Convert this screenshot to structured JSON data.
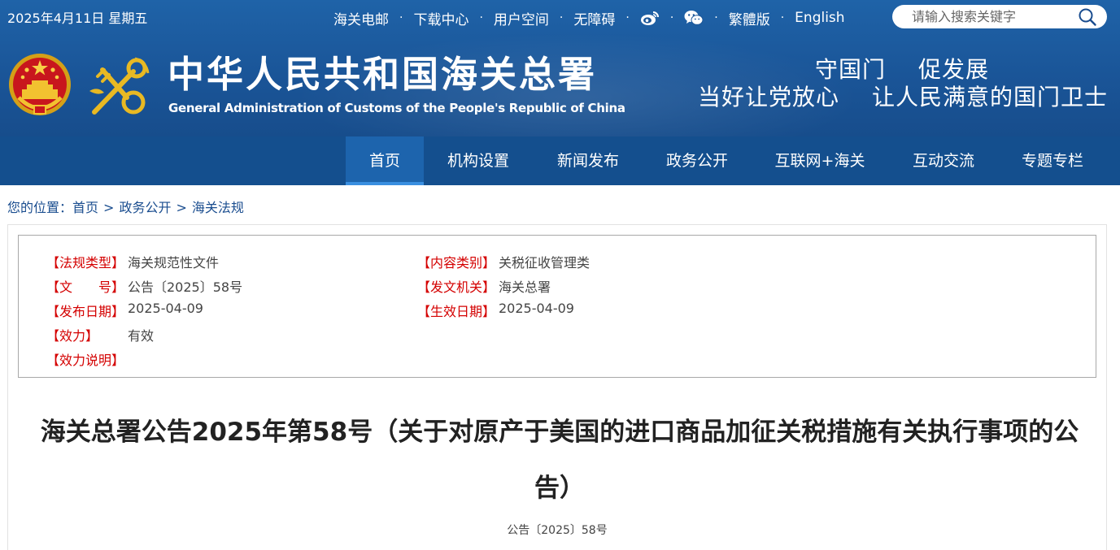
{
  "topbar": {
    "date": "2025年4月11日 星期五",
    "links": [
      "海关电邮",
      "下载中心",
      "用户空间",
      "无障碍",
      "繁體版",
      "English"
    ],
    "weibo_icon": "weibo-icon",
    "wechat_icon": "wechat-icon",
    "search_placeholder": "请输入搜索关键字"
  },
  "header": {
    "title": "中华人民共和国海关总署",
    "subtitle": "General Administration of Customs of the People's Republic of China",
    "slogan_line1": [
      "守国门",
      "促发展"
    ],
    "slogan_line2": [
      "当好让党放心",
      "让人民满意的国门卫士"
    ]
  },
  "nav": {
    "items": [
      "首页",
      "机构设置",
      "新闻发布",
      "政务公开",
      "互联网+海关",
      "互动交流",
      "专题专栏"
    ],
    "active_index": 0
  },
  "breadcrumb": {
    "prefix": "您的位置：",
    "items": [
      "首页",
      "政务公开",
      "海关法规"
    ],
    "separator": ">"
  },
  "meta": {
    "left": [
      {
        "key": "【法规类型】",
        "value": "海关规范性文件"
      },
      {
        "key": "【文　　号】",
        "value": "公告〔2025〕58号"
      },
      {
        "key": "【发布日期】",
        "value": "2025-04-09"
      },
      {
        "key": "【效力】",
        "value": "有效"
      },
      {
        "key": "【效力说明】",
        "value": ""
      }
    ],
    "right": [
      {
        "key": "【内容类别】",
        "value": "关税征收管理类"
      },
      {
        "key": "【发文机关】",
        "value": "海关总署"
      },
      {
        "key": "【生效日期】",
        "value": "2025-04-09"
      }
    ]
  },
  "document": {
    "title": "海关总署公告2025年第58号（关于对原产于美国的进口商品加征关税措施有关执行事项的公告）",
    "number": "公告〔2025〕58号"
  },
  "colors": {
    "header_blue": "#1a5598",
    "nav_blue": "#144f8e",
    "active_blue": "#1d64ad",
    "meta_key_red": "#d40000",
    "breadcrumb_blue": "#1a4d8f"
  }
}
